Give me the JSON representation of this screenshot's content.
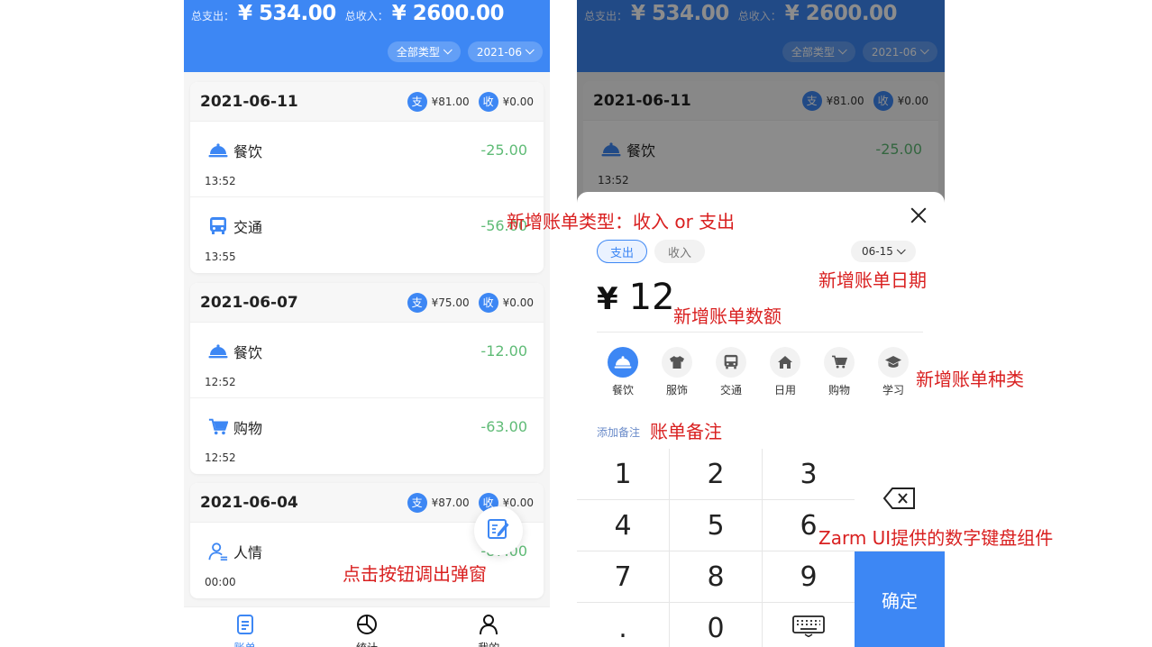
{
  "left": {
    "header": {
      "expense_label": "总支出：",
      "expense_amount": "¥ 534.00",
      "income_label": "总收入：",
      "income_amount": "¥ 2600.00",
      "filter_type": "全部类型",
      "filter_month": "2021-06"
    },
    "days": [
      {
        "date": "2021-06-11",
        "expense_badge": "支",
        "expense": "¥81.00",
        "income_badge": "收",
        "income": "¥0.00",
        "bills": [
          {
            "category": "餐饮",
            "icon": "food-icon",
            "amount": "-25.00",
            "time": "13:52"
          },
          {
            "category": "交通",
            "icon": "bus-icon",
            "amount": "-56.00",
            "time": "13:55"
          }
        ]
      },
      {
        "date": "2021-06-07",
        "expense_badge": "支",
        "expense": "¥75.00",
        "income_badge": "收",
        "income": "¥0.00",
        "bills": [
          {
            "category": "餐饮",
            "icon": "food-icon",
            "amount": "-12.00",
            "time": "12:52"
          },
          {
            "category": "购物",
            "icon": "cart-icon",
            "amount": "-63.00",
            "time": "12:52"
          }
        ]
      },
      {
        "date": "2021-06-04",
        "expense_badge": "支",
        "expense": "¥87.00",
        "income_badge": "收",
        "income": "¥0.00",
        "bills": [
          {
            "category": "人情",
            "icon": "person-icon",
            "amount": "-87.00",
            "time": "00:00"
          }
        ]
      }
    ],
    "tabs": [
      {
        "label": "账单",
        "icon": "bill-icon",
        "active": true
      },
      {
        "label": "统计",
        "icon": "pie-chart-icon",
        "active": false
      },
      {
        "label": "我的",
        "icon": "user-icon",
        "active": false
      }
    ]
  },
  "right": {
    "background": {
      "expense_label": "总支出：",
      "expense_amount": "¥ 534.00",
      "income_label": "总收入：",
      "income_amount": "¥ 2600.00",
      "filter_type": "全部类型",
      "filter_month": "2021-06",
      "date": "2021-06-11",
      "expense_badge": "支",
      "expense": "¥81.00",
      "income_badge": "收",
      "income": "¥0.00",
      "bill_category": "餐饮",
      "bill_amount": "-25.00",
      "bill_time": "13:52"
    },
    "sheet": {
      "expense_tab": "支出",
      "income_tab": "收入",
      "date": "06-15",
      "currency": "¥",
      "amount": "12",
      "types": [
        {
          "label": "餐饮",
          "icon": "food-icon",
          "selected": true
        },
        {
          "label": "服饰",
          "icon": "shirt-icon",
          "selected": false
        },
        {
          "label": "交通",
          "icon": "bus-icon",
          "selected": false
        },
        {
          "label": "日用",
          "icon": "home-icon",
          "selected": false
        },
        {
          "label": "购物",
          "icon": "cart-icon",
          "selected": false
        },
        {
          "label": "学习",
          "icon": "graduation-cap-icon",
          "selected": false
        }
      ],
      "remark": "添加备注",
      "keys": [
        "1",
        "2",
        "3",
        "4",
        "5",
        "6",
        "7",
        "8",
        "9",
        ".",
        "0"
      ],
      "confirm": "确定"
    }
  },
  "annotations": {
    "type": "新增账单类型：收入 or 支出",
    "date": "新增账单日期",
    "amount": "新增账单数额",
    "category": "新增账单种类",
    "remark": "账单备注",
    "keypad": "Zarm UI提供的数字键盘组件",
    "button": "点击按钮调出弹窗"
  },
  "colors": {
    "primary": "#3d87f4",
    "expense_green": "#5fbb76",
    "annotation_red": "#d92020"
  }
}
